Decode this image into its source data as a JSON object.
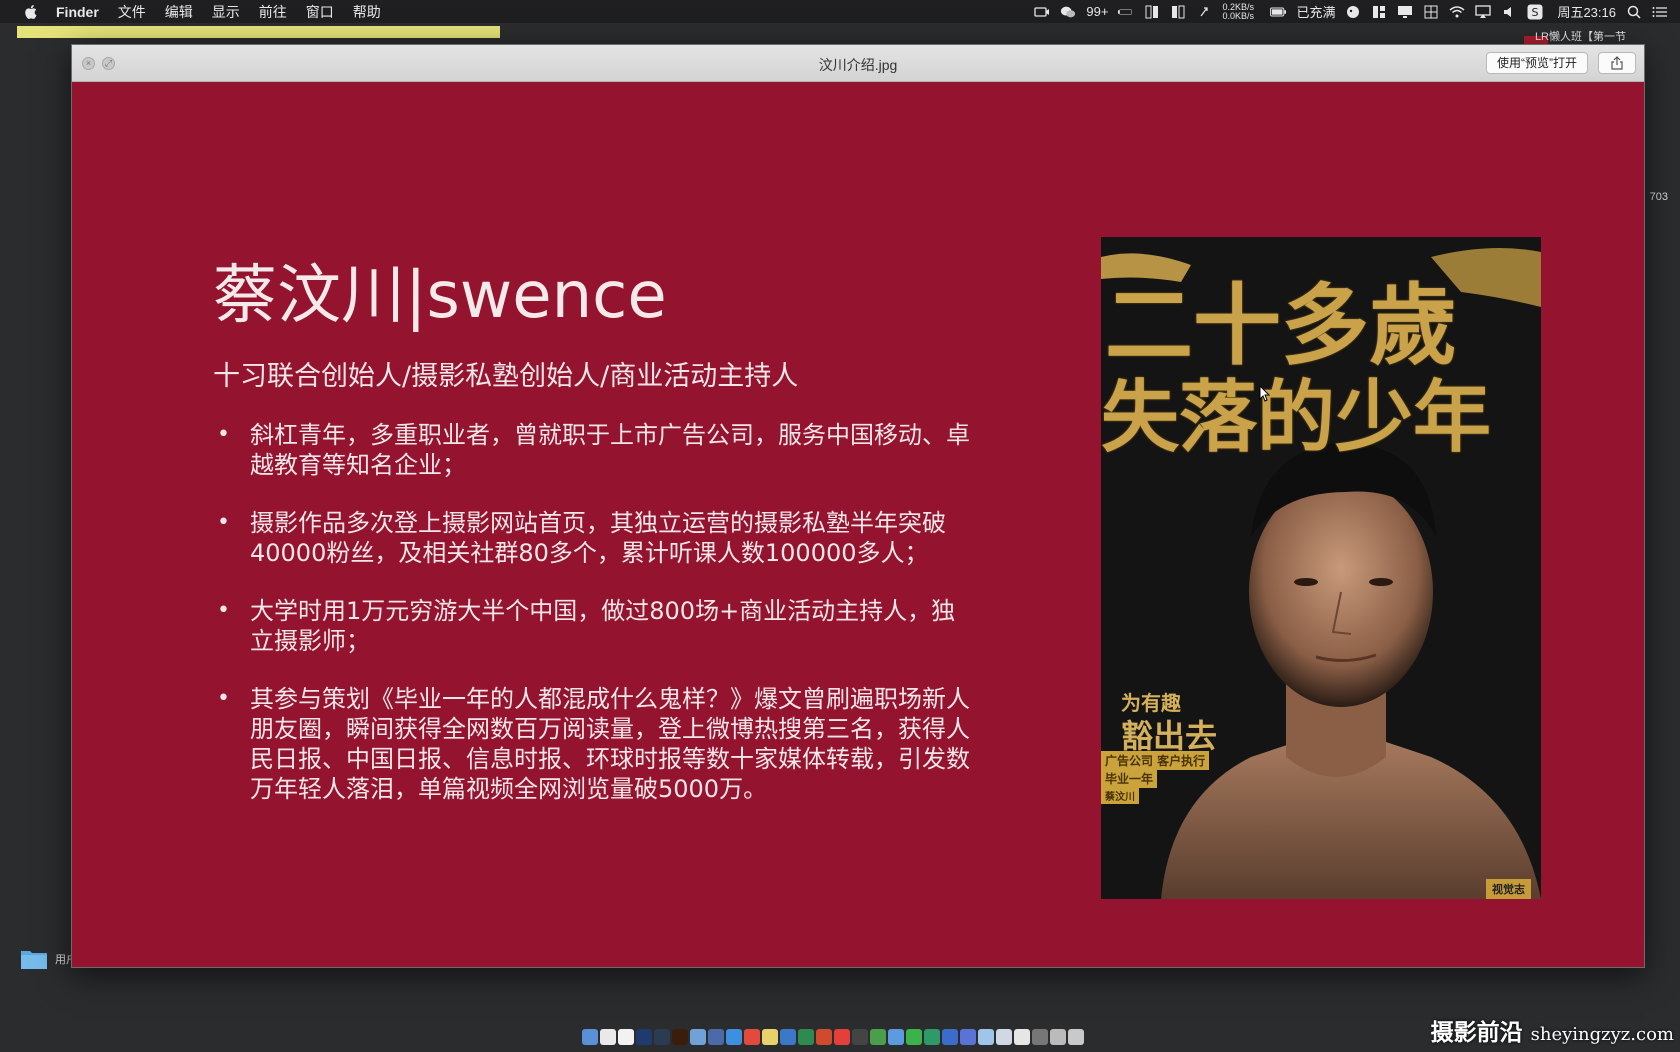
{
  "menubar": {
    "app_name": "Finder",
    "items": [
      "文件",
      "编辑",
      "显示",
      "前往",
      "窗口",
      "帮助"
    ],
    "status": {
      "wechat_badge": "99+",
      "net_up": "0.2KB/s",
      "net_down": "0.0KB/s",
      "battery_text": "已充满",
      "clock": "周五23:16"
    }
  },
  "background": {
    "window_label": "LR懒人班【第一节",
    "side_number": "703",
    "folder_label": "用户"
  },
  "quicklook": {
    "title": "汶川介绍.jpg",
    "open_with_label": "使用“预览”打开"
  },
  "slide": {
    "title": "蔡汶川|swence",
    "subtitle": "十习联合创始人/摄影私塾创始人/商业活动主持人",
    "bullets": [
      "斜杠青年，多重职业者，曾就职于上市广告公司，服务中国移动、卓越教育等知名企业；",
      "摄影作品多次登上摄影网站首页，其独立运营的摄影私塾半年突破40000粉丝，及相关社群80多个，累计听课人数100000多人；",
      "大学时用1万元穷游大半个中国，做过800场+商业活动主持人，独立摄影师；",
      "其参与策划《毕业一年的人都混成什么鬼样？》爆文曾刷遍职场新人朋友圈，瞬间获得全网数百万阅读量，登上微博热搜第三名，获得人民日报、中国日报、信息时报、环球时报等数十家媒体转载，引发数万年轻人落泪，单篇视频全网浏览量破5000万。"
    ],
    "poster": {
      "line_top": "二十多歲",
      "line_mid": "失落的少年",
      "caption_1": "为有趣",
      "caption_2": "豁出去",
      "tag_1": "广告公司 客户执行",
      "tag_2": "毕业一年",
      "tag_3": "蔡汶川",
      "brand": "视觉志"
    }
  },
  "watermark": {
    "cn": "摄影前沿",
    "url": "sheyingzyz.com"
  },
  "colors": {
    "slide_bg": "#94132f",
    "text": "#f3e6e8",
    "gold": "#c9a24a"
  }
}
